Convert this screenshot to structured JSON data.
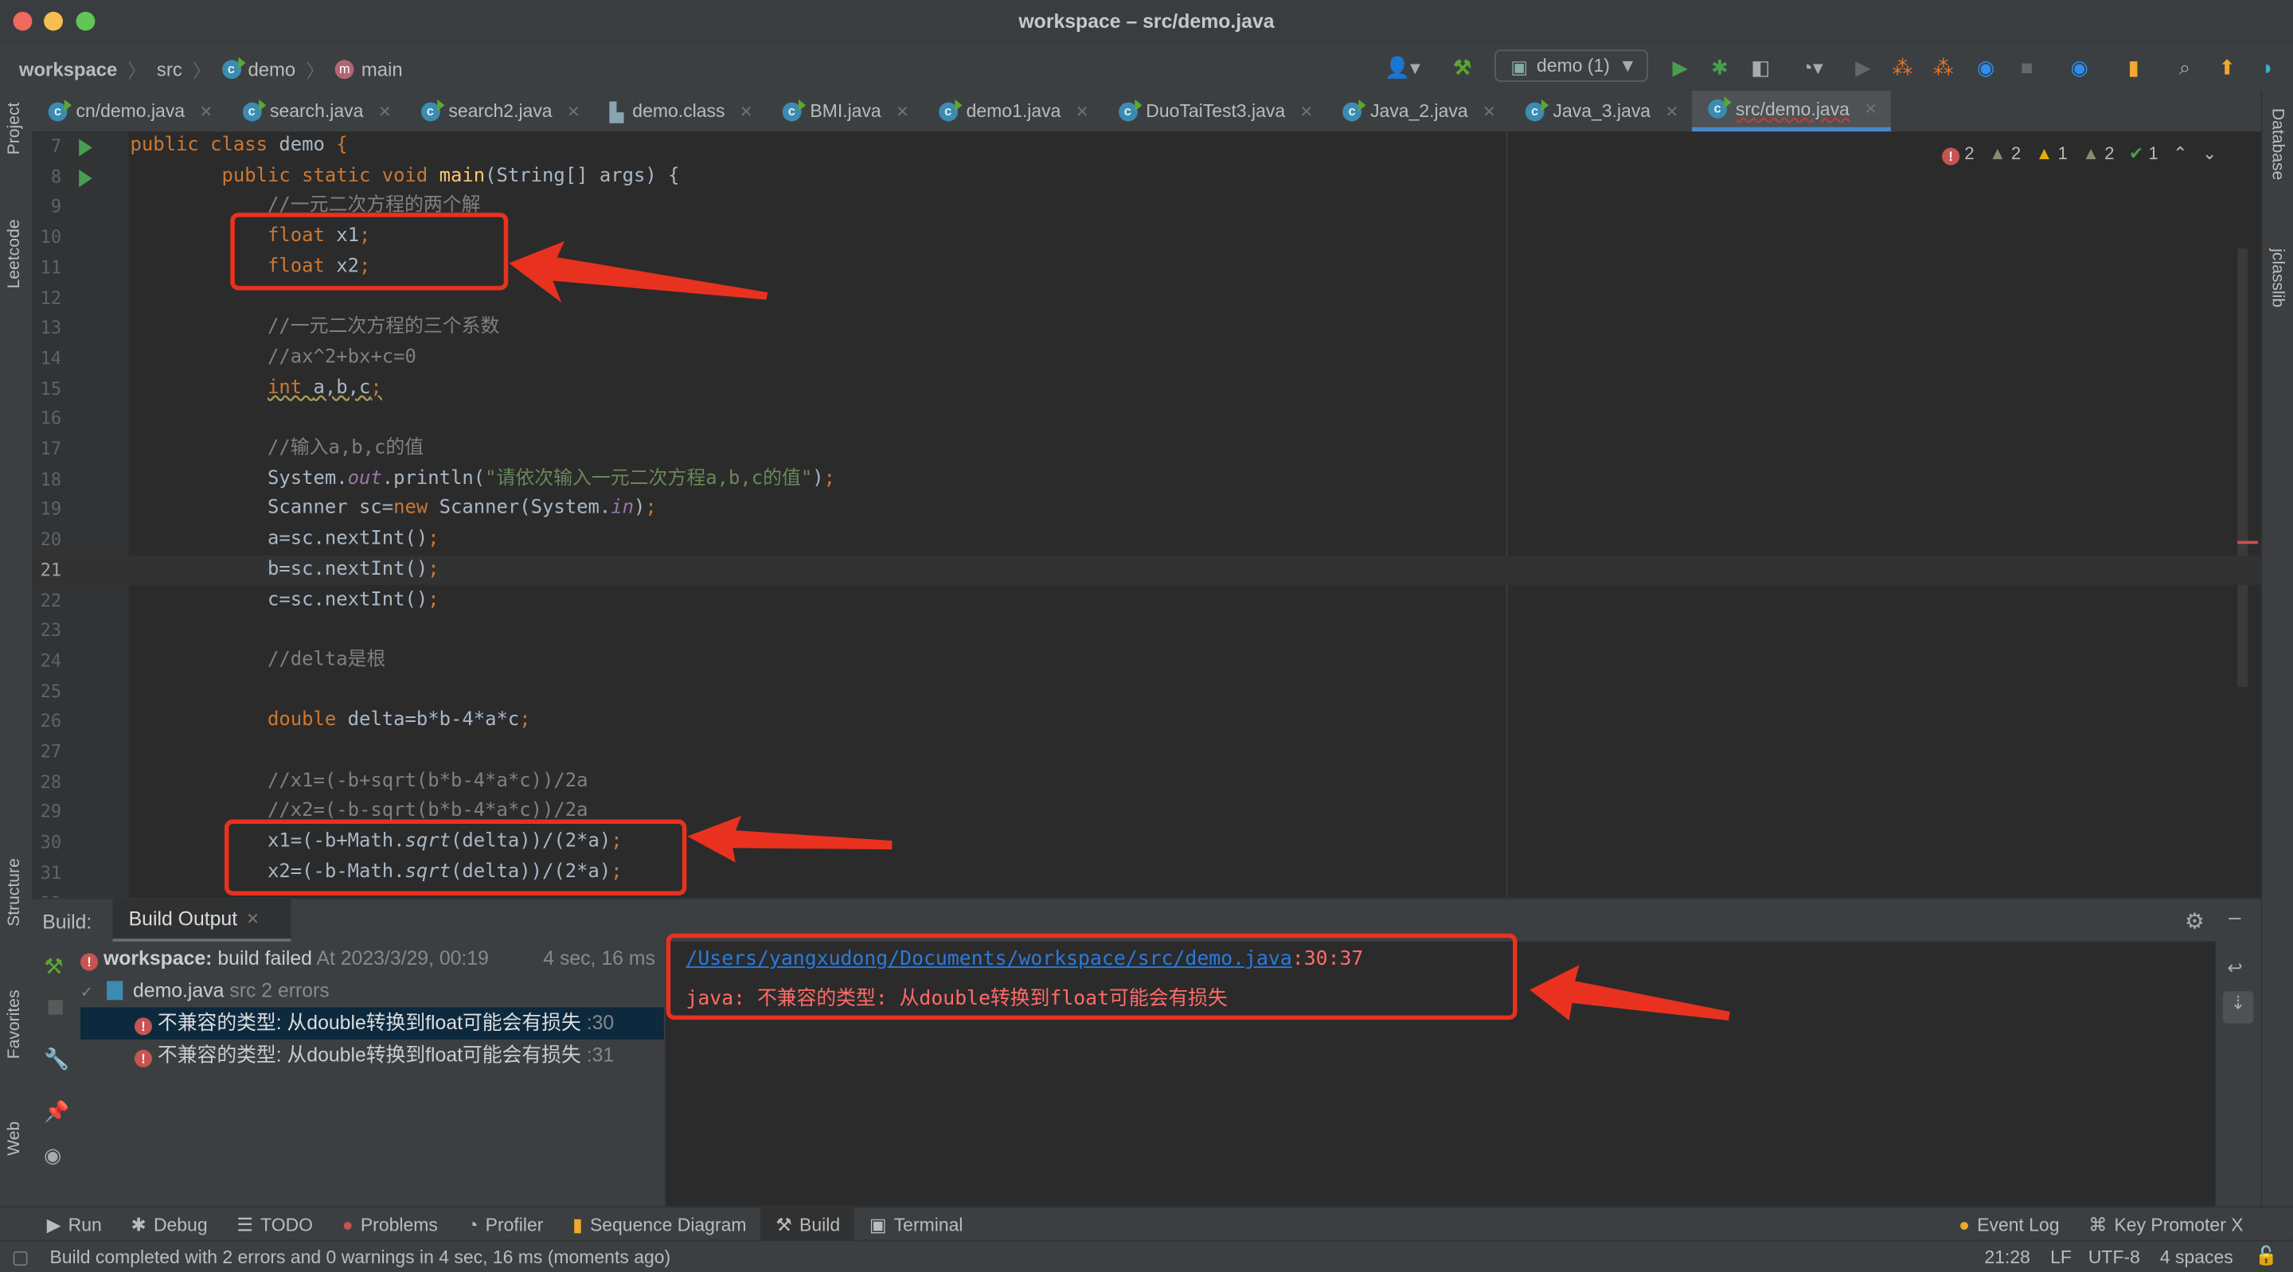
{
  "window": {
    "title": "workspace – src/demo.java"
  },
  "breadcrumb": [
    "workspace",
    "src",
    "demo",
    "main"
  ],
  "toolbar": {
    "run_config": "demo (1)"
  },
  "tabs": [
    {
      "label": "cn/demo.java",
      "icon": "java-class-icon"
    },
    {
      "label": "search.java",
      "icon": "java-class-icon"
    },
    {
      "label": "search2.java",
      "icon": "java-class-icon"
    },
    {
      "label": "demo.class",
      "icon": "class-file-icon"
    },
    {
      "label": "BMI.java",
      "icon": "java-class-icon"
    },
    {
      "label": "demo1.java",
      "icon": "java-class-icon"
    },
    {
      "label": "DuoTaiTest3.java",
      "icon": "java-class-icon"
    },
    {
      "label": "Java_2.java",
      "icon": "java-class-icon"
    },
    {
      "label": "Java_3.java",
      "icon": "java-class-icon"
    },
    {
      "label": "src/demo.java",
      "icon": "java-class-icon",
      "active": true
    }
  ],
  "left_strip": [
    "Project",
    "Leetcode",
    "Structure",
    "Favorites",
    "Web"
  ],
  "right_strip": [
    "Database",
    "jclasslib"
  ],
  "inspections": {
    "errors": "2",
    "warnings": "2",
    "weak_warnings": "1",
    "typos": "2",
    "ok": "1"
  },
  "editor": {
    "current_line": 21,
    "lines": [
      {
        "n": 7,
        "run": true,
        "t": [
          [
            "kw",
            "public class "
          ],
          [
            "plain",
            "demo "
          ],
          [
            "kw",
            "{"
          ]
        ]
      },
      {
        "n": 8,
        "run": true,
        "t": [
          [
            "plain",
            "        "
          ],
          [
            "kw",
            "public static void "
          ],
          [
            "method",
            "main"
          ],
          [
            "plain",
            "(String[] args) {"
          ]
        ]
      },
      {
        "n": 9,
        "t": [
          [
            "comment",
            "            //一元二次方程的两个解"
          ]
        ]
      },
      {
        "n": 10,
        "t": [
          [
            "plain",
            "            "
          ],
          [
            "kw",
            "float "
          ],
          [
            "plain",
            "x1"
          ],
          [
            "kw",
            ";"
          ]
        ]
      },
      {
        "n": 11,
        "t": [
          [
            "plain",
            "            "
          ],
          [
            "kw",
            "float "
          ],
          [
            "plain",
            "x2"
          ],
          [
            "kw",
            ";"
          ]
        ]
      },
      {
        "n": 12,
        "t": []
      },
      {
        "n": 13,
        "t": [
          [
            "comment",
            "            //一元二次方程的三个系数"
          ]
        ]
      },
      {
        "n": 14,
        "t": [
          [
            "comment",
            "            //ax^2+bx+c=0"
          ]
        ]
      },
      {
        "n": 15,
        "t": [
          [
            "plain",
            "            "
          ],
          [
            "kw warn",
            "int "
          ],
          [
            "plain warn",
            "a,b,c"
          ],
          [
            "kw warn",
            ";"
          ]
        ]
      },
      {
        "n": 16,
        "t": []
      },
      {
        "n": 17,
        "t": [
          [
            "comment",
            "            //输入a,b,c的值"
          ]
        ]
      },
      {
        "n": 18,
        "t": [
          [
            "plain",
            "            System."
          ],
          [
            "field",
            "out"
          ],
          [
            "plain",
            ".println("
          ],
          [
            "str",
            "\"请依次输入一元二次方程a,b,c的值\""
          ],
          [
            "plain",
            ")"
          ],
          [
            "kw",
            ";"
          ]
        ]
      },
      {
        "n": 19,
        "t": [
          [
            "plain",
            "            Scanner sc="
          ],
          [
            "kw",
            "new "
          ],
          [
            "plain",
            "Scanner(System."
          ],
          [
            "field",
            "in"
          ],
          [
            "plain",
            ")"
          ],
          [
            "kw",
            ";"
          ]
        ]
      },
      {
        "n": 20,
        "t": [
          [
            "plain",
            "            a=sc.nextInt()"
          ],
          [
            "kw",
            ";"
          ]
        ]
      },
      {
        "n": 21,
        "t": [
          [
            "plain",
            "            b=sc.nextInt()"
          ],
          [
            "kw",
            ";"
          ]
        ]
      },
      {
        "n": 22,
        "t": [
          [
            "plain",
            "            c=sc.nextInt()"
          ],
          [
            "kw",
            ";"
          ]
        ]
      },
      {
        "n": 23,
        "t": []
      },
      {
        "n": 24,
        "t": [
          [
            "comment",
            "            //delta是根"
          ]
        ]
      },
      {
        "n": 25,
        "t": []
      },
      {
        "n": 26,
        "t": [
          [
            "plain",
            "            "
          ],
          [
            "kw",
            "double "
          ],
          [
            "plain",
            "delta=b*b-4*a*c"
          ],
          [
            "kw",
            ";"
          ]
        ]
      },
      {
        "n": 27,
        "t": []
      },
      {
        "n": 28,
        "t": [
          [
            "comment",
            "            //x1=(-b+sqrt(b*b-4*a*c))/2a"
          ]
        ]
      },
      {
        "n": 29,
        "t": [
          [
            "comment",
            "            //x2=(-b-sqrt(b*b-4*a*c))/2a"
          ]
        ]
      },
      {
        "n": 30,
        "t": [
          [
            "plain",
            "            x1=(-b+Math."
          ],
          [
            "italic",
            "sqrt"
          ],
          [
            "plain",
            "(delta))/(2*a)"
          ],
          [
            "kw",
            ";"
          ]
        ]
      },
      {
        "n": 31,
        "t": [
          [
            "plain",
            "            x2=(-b-Math."
          ],
          [
            "italic",
            "sqrt"
          ],
          [
            "plain",
            "(delta))/(2*a)"
          ],
          [
            "kw",
            ";"
          ]
        ]
      },
      {
        "n": 32,
        "t": []
      }
    ]
  },
  "build": {
    "label": "Build:",
    "tab": "Build Output",
    "summary_name": "workspace:",
    "summary_status": "build failed",
    "summary_time": "At 2023/3/29, 00:19",
    "summary_duration": "4 sec, 16 ms",
    "file": "demo.java",
    "file_meta": "src 2 errors",
    "errors": [
      {
        "msg": "不兼容的类型: 从double转换到float可能会有损失",
        "line": ":30"
      },
      {
        "msg": "不兼容的类型: 从double转换到float可能会有损失",
        "line": ":31"
      }
    ],
    "console_link": "/Users/yangxudong/Documents/workspace/src/demo.java",
    "console_pos": ":30:37",
    "console_msg": "java: 不兼容的类型: 从double转换到float可能会有损失"
  },
  "bottom_tools": [
    "Run",
    "Debug",
    "TODO",
    "Problems",
    "Profiler",
    "Sequence Diagram",
    "Build",
    "Terminal"
  ],
  "bottom_right": [
    "Event Log",
    "Key Promoter X"
  ],
  "status": {
    "message": "Build completed with 2 errors and 0 warnings in 4 sec, 16 ms (moments ago)",
    "position": "21:28",
    "line_sep": "LF",
    "encoding": "UTF-8",
    "indent": "4 spaces"
  },
  "colors": {
    "annotation": "#e8321f",
    "accent": "#4a88c7",
    "error": "#c75450",
    "link": "#287bde"
  }
}
